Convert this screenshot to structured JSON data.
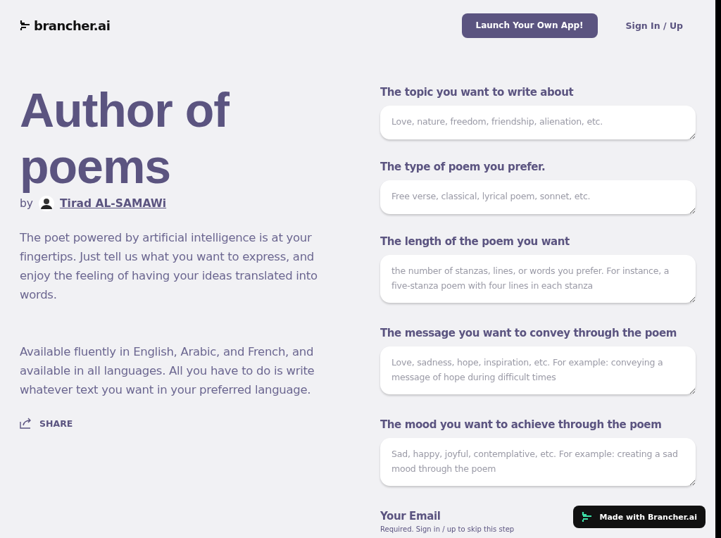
{
  "header": {
    "logo": "brancher.ai",
    "launch_button": "Launch Your Own App!",
    "sign_in": "Sign In / Up"
  },
  "intro": {
    "title": "Author of poems",
    "by": "by",
    "author": "Tirad AL-SAMAWi",
    "paragraphs": [
      "The poet powered by artificial intelligence is at your fingertips. Just tell us what you want to express, and enjoy the feeling of having your ideas translated into words.",
      "Available fluently in English, Arabic, and French, and available in all languages. All you have to do is write whatever text you want in your preferred language."
    ],
    "share": "SHARE"
  },
  "form": {
    "fields": [
      {
        "label": "The topic you want to write about",
        "placeholder": "Love, nature, freedom, friendship, alienation, etc."
      },
      {
        "label": "The type of poem you prefer.",
        "placeholder": "Free verse, classical, lyrical poem, sonnet, etc."
      },
      {
        "label": "The length of the poem you want",
        "placeholder": "the number of stanzas, lines, or words you prefer. For instance, a five-stanza poem with four lines in each stanza"
      },
      {
        "label": "The message you want to convey through the poem",
        "placeholder": "Love, sadness, hope, inspiration, etc. For example: conveying a message of hope during difficult times"
      },
      {
        "label": "The mood you want to achieve through the poem",
        "placeholder": "Sad, happy, joyful, contemplative, etc. For example: creating a sad mood through the poem"
      }
    ],
    "email": {
      "label": "Your Email",
      "hint": "Required. Sign in / up to skip this step"
    }
  },
  "badge": "Made with Brancher.ai"
}
